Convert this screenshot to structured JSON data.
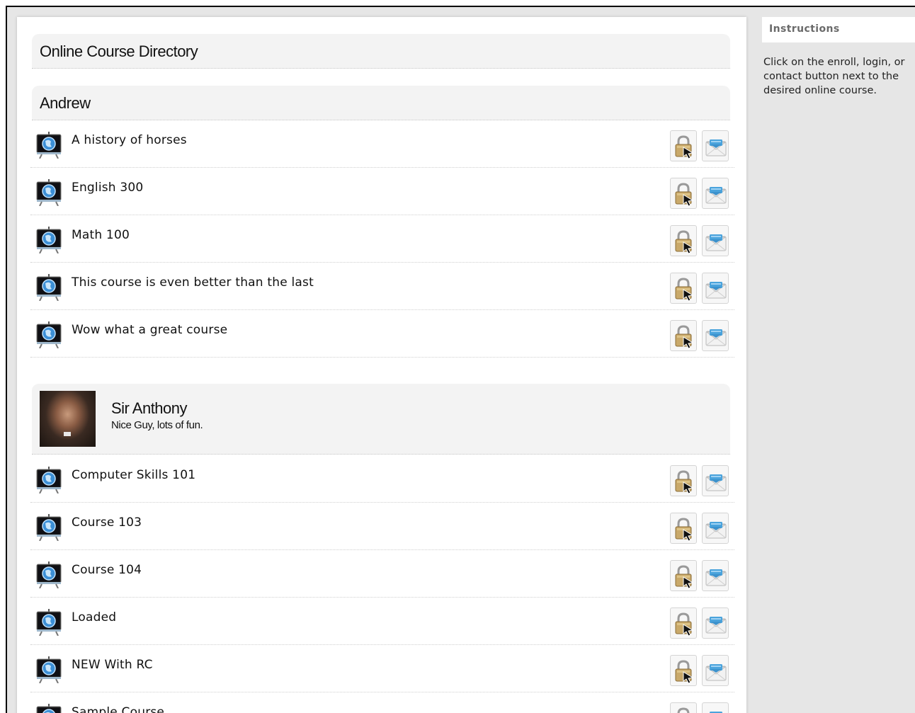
{
  "directory": {
    "title": "Online Course Directory"
  },
  "instructors": [
    {
      "name": "Andrew",
      "courses": [
        "A history of horses",
        "English 300",
        "Math 100",
        "This course is even better than the last",
        "Wow what a great course"
      ]
    },
    {
      "name": "Sir Anthony",
      "bio": "Nice Guy, lots of fun.",
      "courses": [
        "Computer Skills 101",
        "Course 103",
        "Course 104",
        "Loaded",
        "NEW With RC",
        "Sample Course"
      ]
    }
  ],
  "sidebar": {
    "heading": "Instructions",
    "text": "Click on the enroll, login, or contact button next to the desired online course."
  },
  "icons": {
    "course": "course-easel-icon",
    "login": "login-lock-icon",
    "contact": "contact-envelope-icon"
  },
  "colors": {
    "page_bg": "#e6e6e6",
    "panel_bg": "#ffffff",
    "header_bg": "#f3f3f3",
    "accent_blue": "#4aa3dc"
  }
}
